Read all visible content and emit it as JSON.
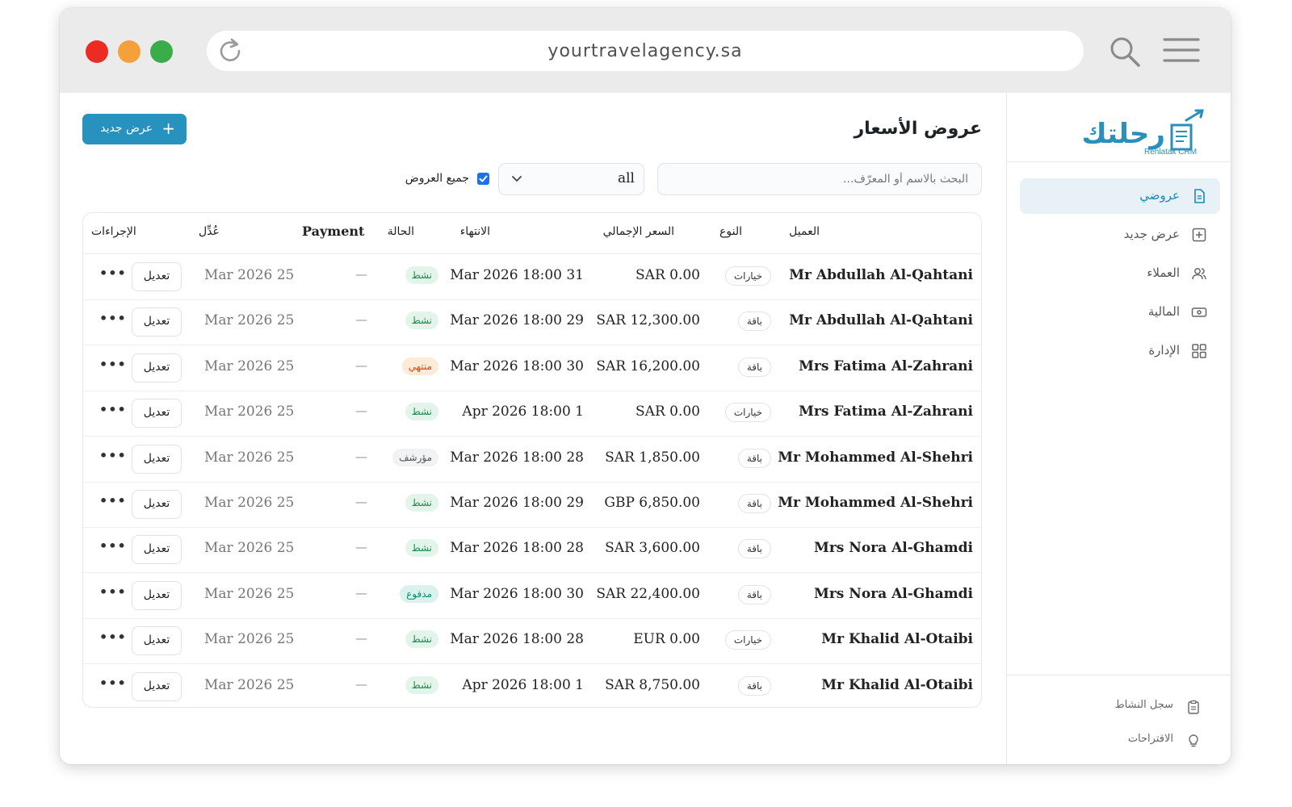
{
  "browser": {
    "url": "yourtravelagency.sa"
  },
  "brand": {
    "logo_text": "رحلتك",
    "logo_sub": "Rehlatak CRM",
    "color": "#2a8fba"
  },
  "sidebar": {
    "items": [
      {
        "label": "عروضي",
        "icon": "document-icon",
        "active": true
      },
      {
        "label": "عرض جديد",
        "icon": "plus-square-icon",
        "active": false
      },
      {
        "label": "العملاء",
        "icon": "users-icon",
        "active": false
      },
      {
        "label": "المالية",
        "icon": "money-icon",
        "active": false
      },
      {
        "label": "الإدارة",
        "icon": "grid-icon",
        "active": false
      }
    ],
    "footer": [
      {
        "label": "سجل النشاط",
        "icon": "clipboard-icon"
      },
      {
        "label": "الاقتراحات",
        "icon": "lightbulb-icon"
      }
    ]
  },
  "page": {
    "title": "عروض الأسعار",
    "new_button": "عرض جديد"
  },
  "filters": {
    "search_placeholder": "البحث بالاسم أو المعرّف...",
    "status_value": "all",
    "all_offers_label": "جميع العروض",
    "all_offers_checked": true
  },
  "table": {
    "headers": {
      "client": "العميل",
      "type": "النوع",
      "total": "السعر الإجمالي",
      "expiry": "الانتهاء",
      "status": "الحالة",
      "payment": "Payment",
      "modified": "عُدِّل",
      "actions": "الإجراءات"
    },
    "edit_label": "تعديل",
    "more_label": "•••",
    "rows": [
      {
        "client": "Mr Abdullah Al-Qahtani",
        "type": "خيارات",
        "total": "SAR 0.00",
        "expiry": "Mar 2026 18:00 31",
        "status": "نشط",
        "status_kind": "active",
        "payment": "—",
        "modified": "Mar 2026 25"
      },
      {
        "client": "Mr Abdullah Al-Qahtani",
        "type": "باقة",
        "total": "SAR 12,300.00",
        "expiry": "Mar 2026 18:00 29",
        "status": "نشط",
        "status_kind": "active",
        "payment": "—",
        "modified": "Mar 2026 25"
      },
      {
        "client": "Mrs Fatima Al-Zahrani",
        "type": "باقة",
        "total": "SAR 16,200.00",
        "expiry": "Mar 2026 18:00 30",
        "status": "منتهي",
        "status_kind": "expired",
        "payment": "—",
        "modified": "Mar 2026 25"
      },
      {
        "client": "Mrs Fatima Al-Zahrani",
        "type": "خيارات",
        "total": "SAR 0.00",
        "expiry": "Apr 2026 18:00 1",
        "status": "نشط",
        "status_kind": "active",
        "payment": "—",
        "modified": "Mar 2026 25"
      },
      {
        "client": "Mr Mohammed Al-Shehri",
        "type": "باقة",
        "total": "SAR 1,850.00",
        "expiry": "Mar 2026 18:00 28",
        "status": "مؤرشف",
        "status_kind": "archived",
        "payment": "—",
        "modified": "Mar 2026 25"
      },
      {
        "client": "Mr Mohammed Al-Shehri",
        "type": "باقة",
        "total": "GBP 6,850.00",
        "expiry": "Mar 2026 18:00 29",
        "status": "نشط",
        "status_kind": "active",
        "payment": "—",
        "modified": "Mar 2026 25"
      },
      {
        "client": "Mrs Nora Al-Ghamdi",
        "type": "باقة",
        "total": "SAR 3,600.00",
        "expiry": "Mar 2026 18:00 28",
        "status": "نشط",
        "status_kind": "active",
        "payment": "—",
        "modified": "Mar 2026 25"
      },
      {
        "client": "Mrs Nora Al-Ghamdi",
        "type": "باقة",
        "total": "SAR 22,400.00",
        "expiry": "Mar 2026 18:00 30",
        "status": "مدفوع",
        "status_kind": "paid",
        "payment": "—",
        "modified": "Mar 2026 25"
      },
      {
        "client": "Mr Khalid Al-Otaibi",
        "type": "خيارات",
        "total": "EUR 0.00",
        "expiry": "Mar 2026 18:00 28",
        "status": "نشط",
        "status_kind": "active",
        "payment": "—",
        "modified": "Mar 2026 25"
      },
      {
        "client": "Mr Khalid Al-Otaibi",
        "type": "باقة",
        "total": "SAR 8,750.00",
        "expiry": "Apr 2026 18:00 1",
        "status": "نشط",
        "status_kind": "active",
        "payment": "—",
        "modified": "Mar 2026 25"
      }
    ]
  },
  "status_colors": {
    "active": {
      "bg": "#e3f5ea",
      "fg": "#1f8a4c"
    },
    "expired": {
      "bg": "#fdebd8",
      "fg": "#d9480f"
    },
    "archived": {
      "bg": "#f1f2f4",
      "fg": "#555555"
    },
    "paid": {
      "bg": "#d9f2ec",
      "fg": "#0f8a73"
    }
  }
}
